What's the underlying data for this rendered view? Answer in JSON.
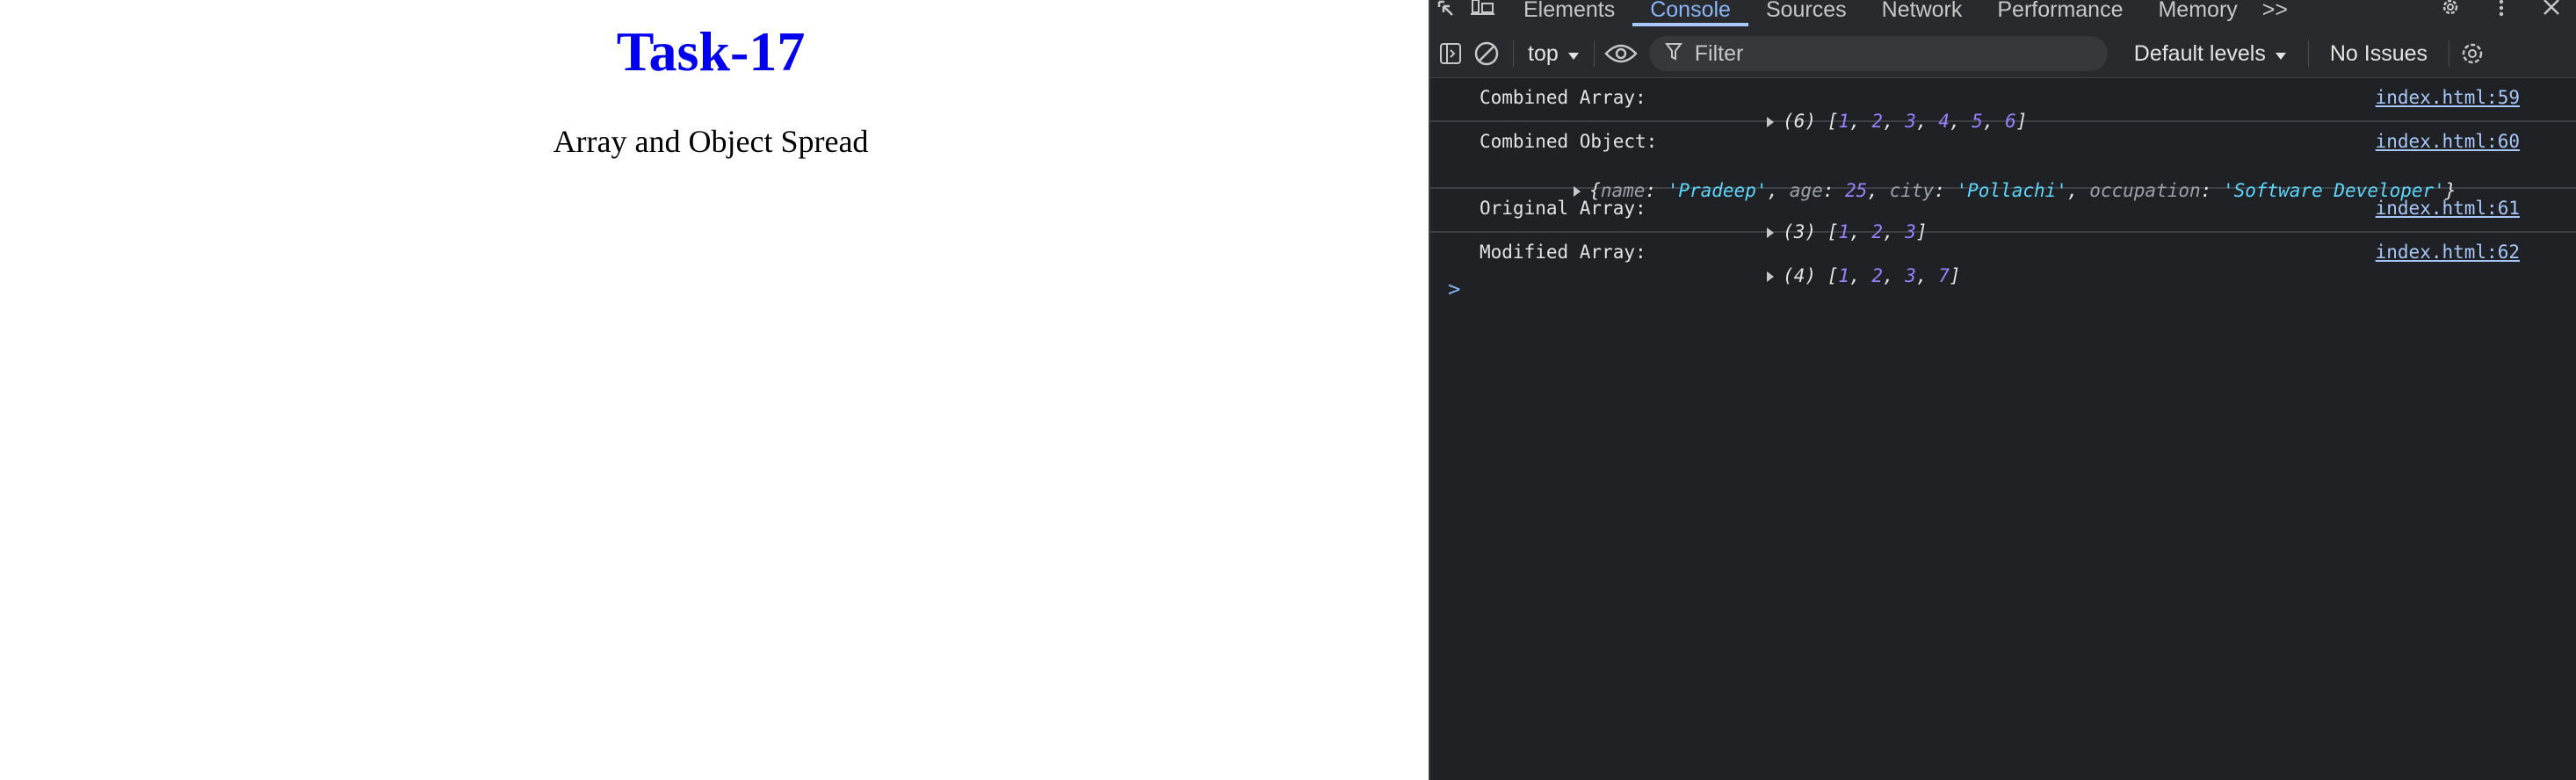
{
  "page": {
    "heading": "Task-17",
    "subtitle": "Array and Object Spread"
  },
  "devtools": {
    "tabs": [
      {
        "label": "Elements",
        "active": false
      },
      {
        "label": "Console",
        "active": true
      },
      {
        "label": "Sources",
        "active": false
      },
      {
        "label": "Network",
        "active": false
      },
      {
        "label": "Performance",
        "active": false
      },
      {
        "label": "Memory",
        "active": false
      }
    ],
    "more_tabs_label": ">>",
    "toolbar": {
      "context": "top",
      "filter_placeholder": "Filter",
      "levels": "Default levels",
      "issues": "No Issues"
    },
    "colors": {
      "background": "#202124",
      "accent": "#8ab4f8",
      "number": "#9980ff",
      "string": "#5cd5fb",
      "link": "#a8c7fa"
    },
    "messages": [
      {
        "label": "Combined Array:",
        "source": "index.html:59",
        "count": "(6)",
        "items": [
          "1",
          "2",
          "3",
          "4",
          "5",
          "6"
        ]
      },
      {
        "label": "Combined Object:",
        "source": "index.html:60",
        "entries": [
          {
            "key": "name",
            "value": "'Pradeep'"
          },
          {
            "key": "age",
            "value": "25"
          },
          {
            "key": "city",
            "value": "'Pollachi'"
          },
          {
            "key": "occupation",
            "value": "'Software Developer'"
          }
        ]
      },
      {
        "label": "Original Array:",
        "source": "index.html:61",
        "count": "(3)",
        "items": [
          "1",
          "2",
          "3"
        ]
      },
      {
        "label": "Modified Array:",
        "source": "index.html:62",
        "count": "(4)",
        "items": [
          "1",
          "2",
          "3",
          "7"
        ]
      }
    ],
    "prompt_glyph": ">"
  }
}
